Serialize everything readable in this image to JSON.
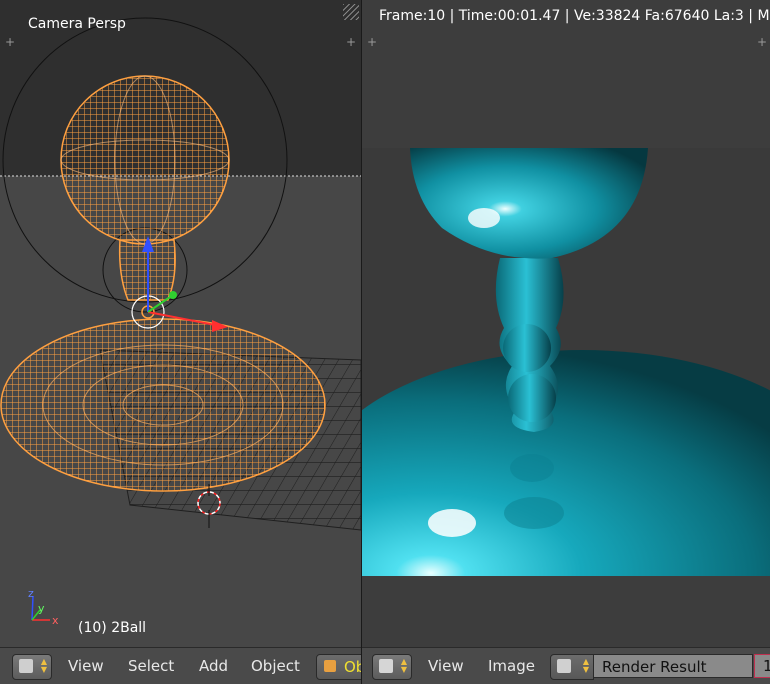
{
  "left_view": {
    "title": "Camera Persp",
    "object_label": "(10) 2Ball",
    "header": {
      "menu": [
        "View",
        "Select",
        "Add",
        "Object"
      ],
      "mode_label": "Object Mode"
    }
  },
  "right_view": {
    "info": "Frame:10 | Time:00:01.47 | Ve:33824 Fa:67640 La:3 | M",
    "header": {
      "menu": [
        "View",
        "Image"
      ],
      "image_name": "Render Result",
      "slot": "1"
    }
  },
  "colors": {
    "wire": "#ffa040",
    "render_cyan": "#1aa0b0",
    "accent_yellow": "#f0e030"
  }
}
